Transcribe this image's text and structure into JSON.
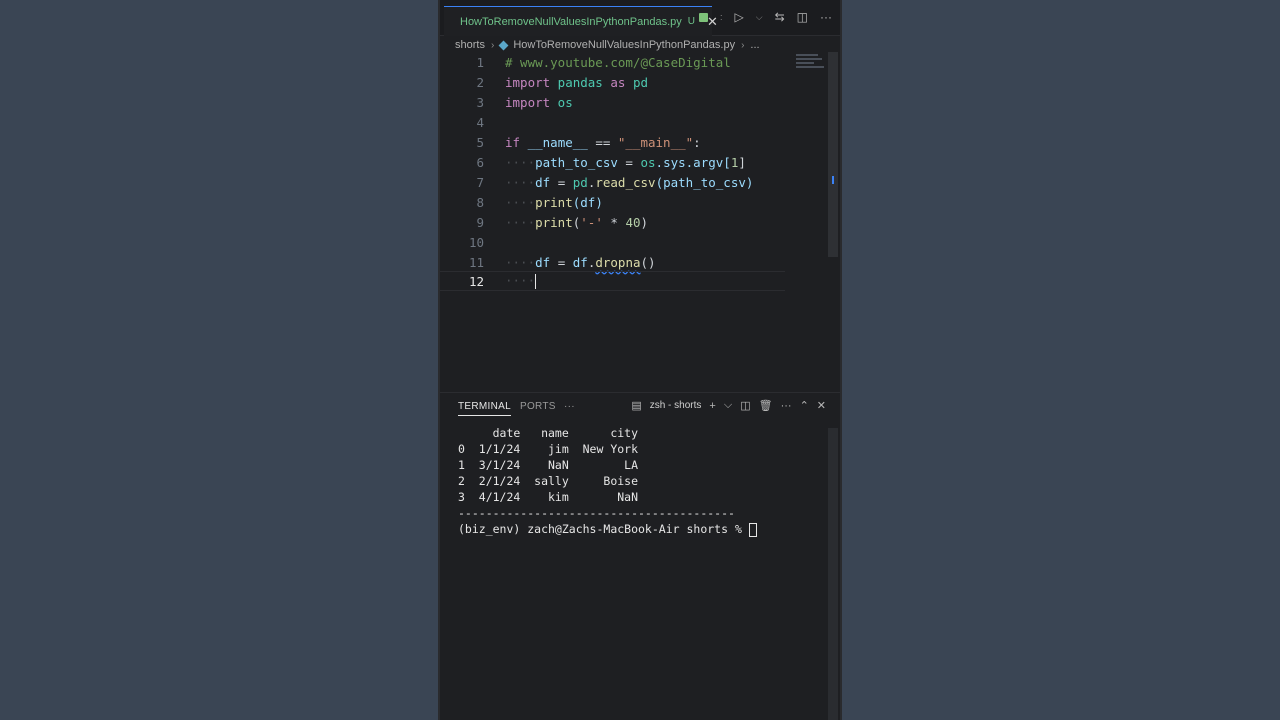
{
  "tab": {
    "filename": "HowToRemoveNullValuesInPythonPandas.py",
    "status": "U",
    "close": "✕"
  },
  "tab_actions": {
    "run": "▷",
    "chevron": "⌵",
    "compare": "⇆",
    "split": "◫",
    "more": "···"
  },
  "breadcrumb": {
    "folder": "shorts",
    "file": "HowToRemoveNullValuesInPythonPandas.py",
    "more": "..."
  },
  "editor": {
    "line_numbers": [
      "1",
      "2",
      "3",
      "4",
      "5",
      "6",
      "7",
      "8",
      "9",
      "10",
      "11",
      "12"
    ],
    "lines": {
      "l1": "# www.youtube.com/@CaseDigital",
      "l2_kw": "import",
      "l2_mod": " pandas ",
      "l2_as": "as",
      "l2_alias": " pd",
      "l3_kw": "import",
      "l3_mod": " os",
      "l5_if": "if",
      "l5_name": " __name__ ",
      "l5_eq": "== ",
      "l5_str": "\"__main__\"",
      "l5_colon": ":",
      "l6_var": "path_to_csv",
      "l6_eq": " = ",
      "l6_os": "os",
      "l6_rest": ".sys.argv[",
      "l6_num": "1",
      "l6_end": "]",
      "l7_var": "df",
      "l7_eq": " = ",
      "l7_pd": "pd",
      "l7_dot": ".",
      "l7_fn": "read_csv",
      "l7_args": "(path_to_csv)",
      "l8_fn": "print",
      "l8_args": "(df)",
      "l9_fn": "print",
      "l9_open": "(",
      "l9_str": "'-'",
      "l9_op": " * ",
      "l9_num": "40",
      "l9_close": ")",
      "l11_var": "df",
      "l11_eq": " = ",
      "l11_obj": "df",
      "l11_dot": ".",
      "l11_fn": "dropna",
      "l11_args": "()"
    }
  },
  "panel": {
    "tabs": [
      "TERMINAL",
      "PORTS",
      "···"
    ],
    "terminal_name": "zsh - shorts",
    "add": "+",
    "chevron": "⌵",
    "split": "◫",
    "trash": "🗑",
    "more": "···",
    "maximize": "⌃",
    "close": "✕"
  },
  "terminal": {
    "header": "     date   name      city",
    "rows": [
      "0  1/1/24    jim  New York",
      "1  3/1/24    NaN        LA",
      "2  2/1/24  sally     Boise",
      "3  4/1/24    kim       NaN"
    ],
    "divider": "----------------------------------------",
    "prompt": "(biz_env) zach@Zachs-MacBook-Air shorts % "
  }
}
